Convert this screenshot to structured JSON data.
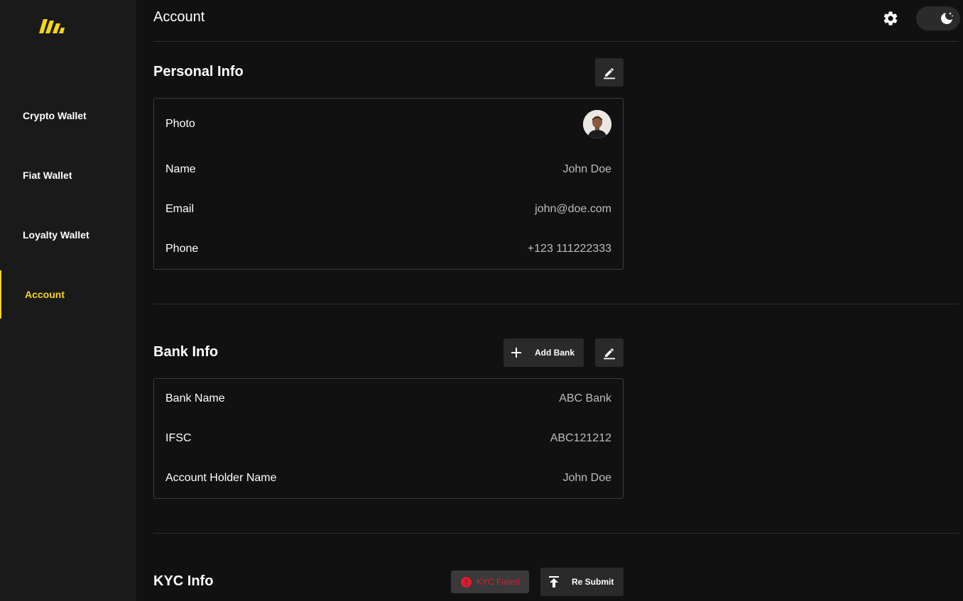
{
  "sidebar": {
    "items": [
      {
        "label": "Crypto Wallet"
      },
      {
        "label": "Fiat Wallet"
      },
      {
        "label": "Loyalty Wallet"
      },
      {
        "label": "Account",
        "active": true
      }
    ],
    "accent_color": "#f7d417"
  },
  "header": {
    "title": "Account",
    "settings_icon": "gear-icon",
    "theme_icon": "moon-icon"
  },
  "personal": {
    "title": "Personal Info",
    "edit_icon": "edit-icon",
    "rows": [
      {
        "label": "Photo",
        "value": ""
      },
      {
        "label": "Name",
        "value": "John Doe"
      },
      {
        "label": "Email",
        "value": "john@doe.com"
      },
      {
        "label": "Phone",
        "value": "+123 111222333"
      }
    ]
  },
  "bank": {
    "title": "Bank Info",
    "add_label": "Add Bank",
    "rows": [
      {
        "label": "Bank Name",
        "value": "ABC Bank"
      },
      {
        "label": "IFSC",
        "value": "ABC121212"
      },
      {
        "label": "Account Holder Name",
        "value": "John Doe"
      }
    ]
  },
  "kyc": {
    "title": "KYC Info",
    "status_label": "KYC Failed",
    "status_color": "#e5192f",
    "resubmit_label": "Re Submit"
  }
}
